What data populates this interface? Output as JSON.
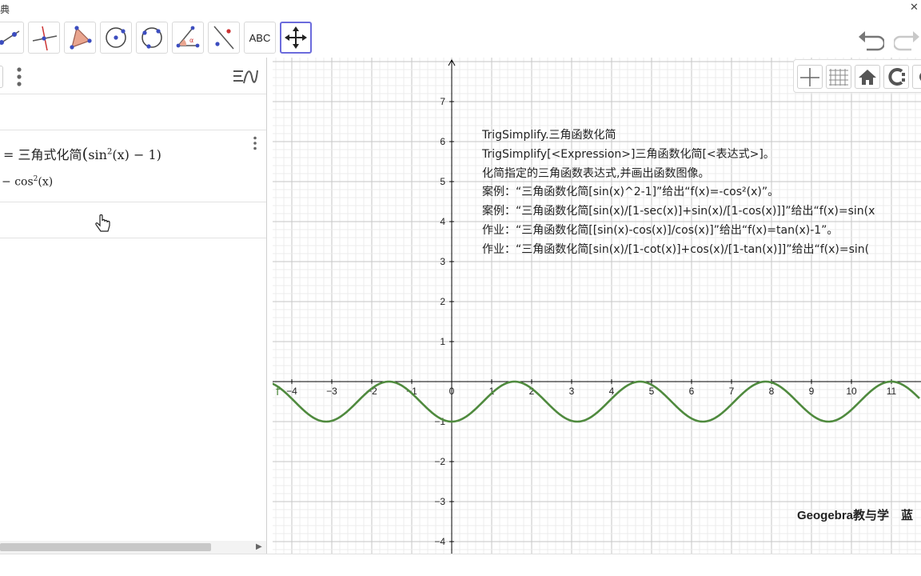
{
  "window": {
    "title_fragment": "典",
    "close_glyph": "✕"
  },
  "toolbar": {
    "tools": [
      {
        "name": "line-tool-icon"
      },
      {
        "name": "perpendicular-line-tool-icon"
      },
      {
        "name": "polygon-tool-icon"
      },
      {
        "name": "circle-center-point-tool-icon"
      },
      {
        "name": "circle-three-points-tool-icon"
      },
      {
        "name": "angle-tool-icon"
      },
      {
        "name": "reflect-line-tool-icon"
      },
      {
        "name": "text-tool",
        "label": "ABC"
      },
      {
        "name": "move-graphics-view-tool-icon",
        "active": true
      }
    ],
    "undo_icon": "undo-icon",
    "redo_icon": "redo-icon"
  },
  "algebra": {
    "entry1": {
      "prefix": "=",
      "func": "三角式化简",
      "sin": "sin",
      "sup": "2",
      "args": "(x)",
      "rest": "− 1)"
    },
    "entry2": {
      "minus": "−",
      "cos": "cos",
      "sup": "2",
      "args": "(x)"
    }
  },
  "graphics": {
    "function_label": "f",
    "info_lines": [
      "TrigSimplify.三角函数化简",
      "TrigSimplify[<Expression>]三角函数化简[<表达式>]。",
      "化简指定的三角函数表达式,并画出函数图像。",
      "案例：“三角函数化简[sin(x)^2-1]”给出“f(x)=-cos²(x)”。",
      "案例：“三角函数化简[sin(x)/[1-sec(x)]+sin(x)/[1-cos(x)]]”给出“f(x)=sin(x",
      "作业：“三角函数化简[[sin(x)-cos(x)]/cos(x)]”给出“f(x)=tan(x)-1”。",
      "作业：“三角函数化简[sin(x)/[1-cot(x)]+cos(x)/[1-tan(x)]]”给出“f(x)=sin("
    ],
    "brand": "Geogebra教与学　蓝",
    "axis_color": "#000000",
    "curve_color": "#4f8a3e"
  },
  "chart_data": {
    "type": "line",
    "title": "",
    "xlabel": "",
    "ylabel": "",
    "xlim": [
      -4.5,
      11.7
    ],
    "ylim": [
      -4.3,
      8
    ],
    "x_ticks": [
      -4,
      -3,
      -2,
      -1,
      0,
      1,
      2,
      3,
      4,
      5,
      6,
      7,
      8,
      9,
      10,
      11
    ],
    "y_ticks": [
      -4,
      -3,
      -2,
      -1,
      1,
      2,
      3,
      4,
      5,
      6,
      7
    ],
    "grid": true,
    "series": [
      {
        "name": "f",
        "function": "-cos²(x)",
        "color": "#4f8a3e"
      }
    ]
  }
}
